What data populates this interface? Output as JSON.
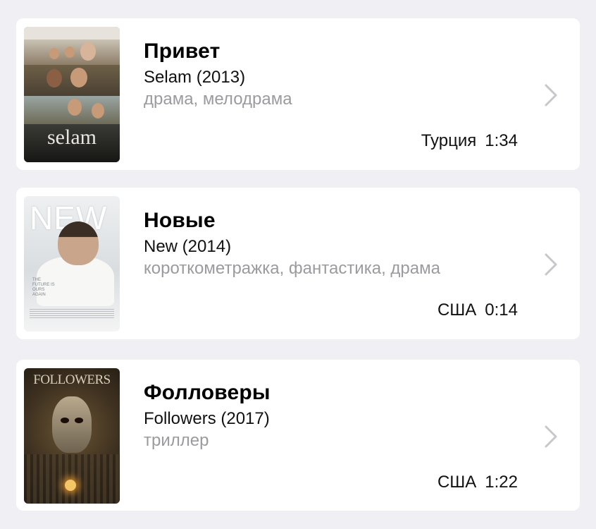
{
  "movies": [
    {
      "title": "Привет",
      "original": "Selam (2013)",
      "genres": "драма, мелодрама",
      "country": "Турция",
      "duration": "1:34",
      "poster_text": "selam"
    },
    {
      "title": "Новые",
      "original": "New (2014)",
      "genres": "короткометражка, фантастика, драма",
      "country": "США",
      "duration": "0:14",
      "poster_text": "NEW",
      "poster_tagline": "THE FUTURE IS OURS AGAIN"
    },
    {
      "title": "Фолловеры",
      "original": "Followers (2017)",
      "genres": "триллер",
      "country": "США",
      "duration": "1:22",
      "poster_text": "FOLLOWERS"
    }
  ],
  "icons": {
    "row_action": "chevron-right-icon"
  },
  "colors": {
    "background": "#efeff4",
    "card": "#ffffff",
    "secondary_text": "#9b9b9f",
    "chevron": "#c7c7cc"
  }
}
